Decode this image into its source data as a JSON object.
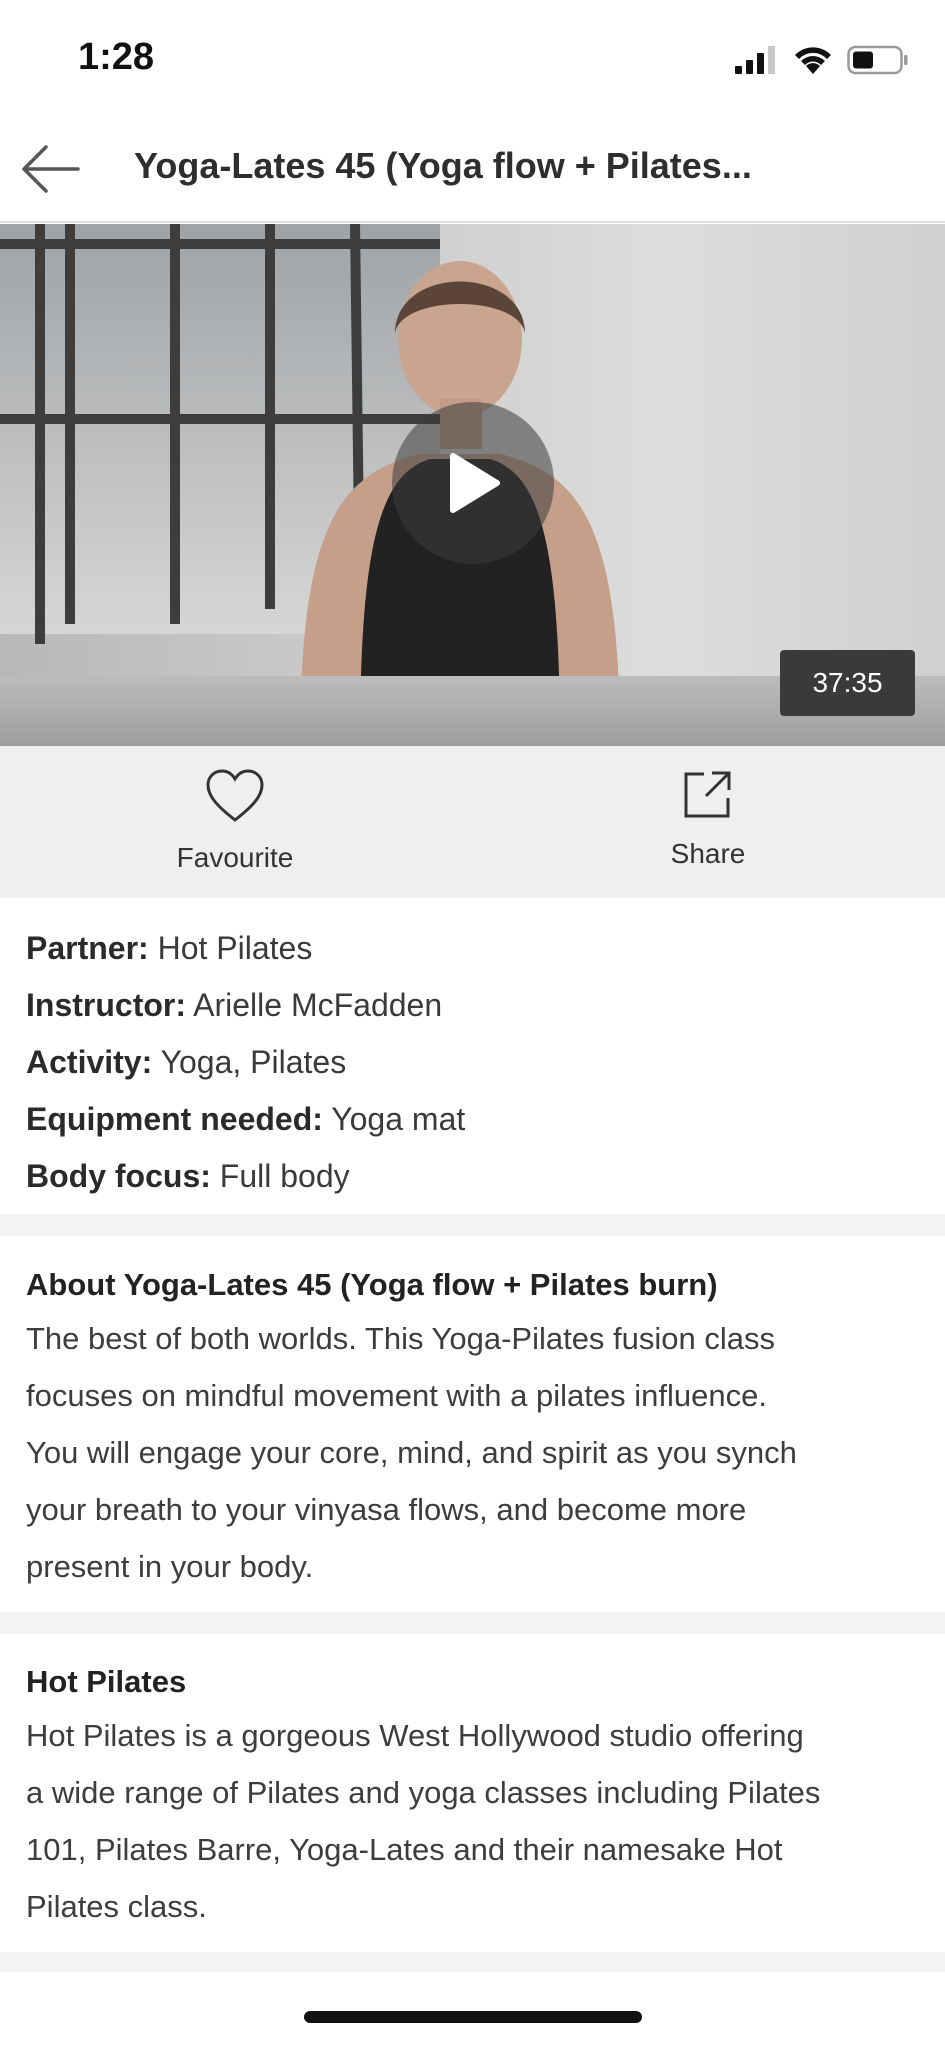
{
  "status": {
    "time": "1:28"
  },
  "nav": {
    "title": "Yoga-Lates 45 (Yoga flow + Pilates..."
  },
  "video": {
    "duration": "37:35"
  },
  "actions": {
    "favourite_label": "Favourite",
    "share_label": "Share"
  },
  "details": [
    {
      "key": "Partner:",
      "value": " Hot Pilates"
    },
    {
      "key": "Instructor:",
      "value": " Arielle McFadden"
    },
    {
      "key": "Activity:",
      "value": " Yoga, Pilates"
    },
    {
      "key": "Equipment needed:",
      "value": " Yoga mat"
    },
    {
      "key": "Body focus:",
      "value": " Full body"
    }
  ],
  "about": {
    "title": "About Yoga-Lates 45 (Yoga flow + Pilates burn)",
    "lines": [
      "The best of both worlds. This Yoga-Pilates fusion class",
      "focuses on mindful movement with a pilates influence.",
      "You will engage your core, mind, and spirit as you synch",
      "your breath to your vinyasa flows, and become more",
      "present in your body."
    ]
  },
  "partner": {
    "title": "Hot Pilates",
    "lines": [
      "Hot Pilates is a gorgeous West Hollywood studio offering",
      "a wide range of Pilates and yoga classes including Pilates",
      "101, Pilates Barre, Yoga-Lates and their namesake Hot",
      "Pilates class."
    ]
  },
  "icons": {
    "back": "arrow-left-icon",
    "play": "play-icon",
    "favourite": "heart-icon",
    "share": "share-icon"
  }
}
